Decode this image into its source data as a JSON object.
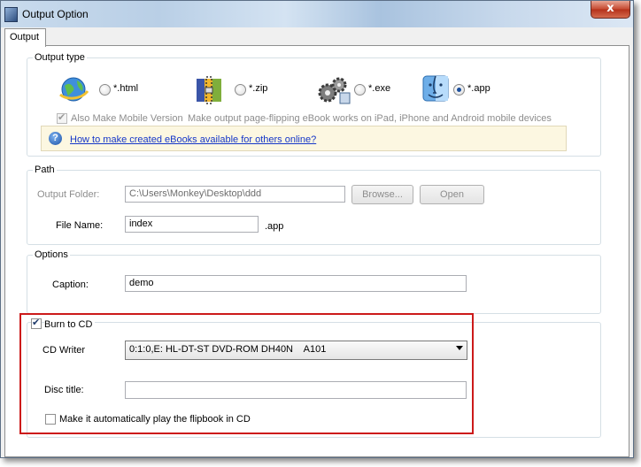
{
  "window": {
    "title": "Output Option",
    "close_glyph": "x"
  },
  "tabs": [
    {
      "label": "Output"
    }
  ],
  "output_type": {
    "group_label": "Output type",
    "options": [
      {
        "label": "*.html",
        "icon": "globe-icon",
        "selected": false
      },
      {
        "label": "*.zip",
        "icon": "zip-archive-icon",
        "selected": false
      },
      {
        "label": "*.exe",
        "icon": "gears-icon",
        "selected": false
      },
      {
        "label": "*.app",
        "icon": "mac-finder-icon",
        "selected": true
      }
    ],
    "mobile_checkbox": {
      "label": "Also Make Mobile Version",
      "checked": true,
      "enabled": false
    },
    "mobile_hint": "Make output page-flipping eBook works on iPad, iPhone and Android mobile devices",
    "help_link": "How to make created eBooks available for others online?"
  },
  "path": {
    "group_label": "Path",
    "output_folder_label": "Output Folder:",
    "output_folder_value": "C:\\Users\\Monkey\\Desktop\\ddd",
    "browse_label": "Browse...",
    "open_label": "Open",
    "file_name_label": "File Name:",
    "file_name_value": "index",
    "extension": ".app"
  },
  "options": {
    "group_label": "Options",
    "caption_label": "Caption:",
    "caption_value": "demo"
  },
  "burn": {
    "checkbox_label": "Burn to CD",
    "checked": true,
    "cd_writer_label": "CD Writer",
    "cd_writer_value": "0:1:0,E: HL-DT-ST DVD-ROM DH40N    A101",
    "disc_title_label": "Disc title:",
    "disc_title_value": "",
    "autoplay_label": "Make it automatically play the flipbook in CD",
    "autoplay_checked": false
  },
  "colors": {
    "highlight": "#cc1a1a",
    "link": "#1536c8",
    "accent": "#1c4f9c"
  }
}
